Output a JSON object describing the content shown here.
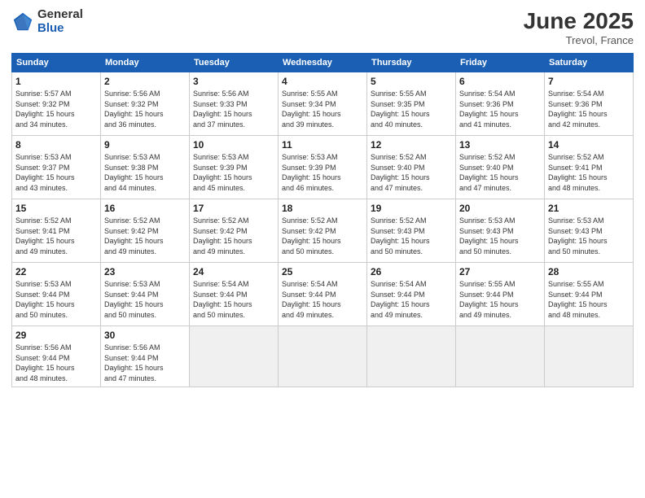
{
  "header": {
    "logo_general": "General",
    "logo_blue": "Blue",
    "title": "June 2025",
    "location": "Trevol, France"
  },
  "columns": [
    "Sunday",
    "Monday",
    "Tuesday",
    "Wednesday",
    "Thursday",
    "Friday",
    "Saturday"
  ],
  "weeks": [
    [
      {
        "day": "1",
        "info": "Sunrise: 5:57 AM\nSunset: 9:32 PM\nDaylight: 15 hours\nand 34 minutes."
      },
      {
        "day": "2",
        "info": "Sunrise: 5:56 AM\nSunset: 9:32 PM\nDaylight: 15 hours\nand 36 minutes."
      },
      {
        "day": "3",
        "info": "Sunrise: 5:56 AM\nSunset: 9:33 PM\nDaylight: 15 hours\nand 37 minutes."
      },
      {
        "day": "4",
        "info": "Sunrise: 5:55 AM\nSunset: 9:34 PM\nDaylight: 15 hours\nand 39 minutes."
      },
      {
        "day": "5",
        "info": "Sunrise: 5:55 AM\nSunset: 9:35 PM\nDaylight: 15 hours\nand 40 minutes."
      },
      {
        "day": "6",
        "info": "Sunrise: 5:54 AM\nSunset: 9:36 PM\nDaylight: 15 hours\nand 41 minutes."
      },
      {
        "day": "7",
        "info": "Sunrise: 5:54 AM\nSunset: 9:36 PM\nDaylight: 15 hours\nand 42 minutes."
      }
    ],
    [
      {
        "day": "8",
        "info": "Sunrise: 5:53 AM\nSunset: 9:37 PM\nDaylight: 15 hours\nand 43 minutes."
      },
      {
        "day": "9",
        "info": "Sunrise: 5:53 AM\nSunset: 9:38 PM\nDaylight: 15 hours\nand 44 minutes."
      },
      {
        "day": "10",
        "info": "Sunrise: 5:53 AM\nSunset: 9:39 PM\nDaylight: 15 hours\nand 45 minutes."
      },
      {
        "day": "11",
        "info": "Sunrise: 5:53 AM\nSunset: 9:39 PM\nDaylight: 15 hours\nand 46 minutes."
      },
      {
        "day": "12",
        "info": "Sunrise: 5:52 AM\nSunset: 9:40 PM\nDaylight: 15 hours\nand 47 minutes."
      },
      {
        "day": "13",
        "info": "Sunrise: 5:52 AM\nSunset: 9:40 PM\nDaylight: 15 hours\nand 47 minutes."
      },
      {
        "day": "14",
        "info": "Sunrise: 5:52 AM\nSunset: 9:41 PM\nDaylight: 15 hours\nand 48 minutes."
      }
    ],
    [
      {
        "day": "15",
        "info": "Sunrise: 5:52 AM\nSunset: 9:41 PM\nDaylight: 15 hours\nand 49 minutes."
      },
      {
        "day": "16",
        "info": "Sunrise: 5:52 AM\nSunset: 9:42 PM\nDaylight: 15 hours\nand 49 minutes."
      },
      {
        "day": "17",
        "info": "Sunrise: 5:52 AM\nSunset: 9:42 PM\nDaylight: 15 hours\nand 49 minutes."
      },
      {
        "day": "18",
        "info": "Sunrise: 5:52 AM\nSunset: 9:42 PM\nDaylight: 15 hours\nand 50 minutes."
      },
      {
        "day": "19",
        "info": "Sunrise: 5:52 AM\nSunset: 9:43 PM\nDaylight: 15 hours\nand 50 minutes."
      },
      {
        "day": "20",
        "info": "Sunrise: 5:53 AM\nSunset: 9:43 PM\nDaylight: 15 hours\nand 50 minutes."
      },
      {
        "day": "21",
        "info": "Sunrise: 5:53 AM\nSunset: 9:43 PM\nDaylight: 15 hours\nand 50 minutes."
      }
    ],
    [
      {
        "day": "22",
        "info": "Sunrise: 5:53 AM\nSunset: 9:44 PM\nDaylight: 15 hours\nand 50 minutes."
      },
      {
        "day": "23",
        "info": "Sunrise: 5:53 AM\nSunset: 9:44 PM\nDaylight: 15 hours\nand 50 minutes."
      },
      {
        "day": "24",
        "info": "Sunrise: 5:54 AM\nSunset: 9:44 PM\nDaylight: 15 hours\nand 50 minutes."
      },
      {
        "day": "25",
        "info": "Sunrise: 5:54 AM\nSunset: 9:44 PM\nDaylight: 15 hours\nand 49 minutes."
      },
      {
        "day": "26",
        "info": "Sunrise: 5:54 AM\nSunset: 9:44 PM\nDaylight: 15 hours\nand 49 minutes."
      },
      {
        "day": "27",
        "info": "Sunrise: 5:55 AM\nSunset: 9:44 PM\nDaylight: 15 hours\nand 49 minutes."
      },
      {
        "day": "28",
        "info": "Sunrise: 5:55 AM\nSunset: 9:44 PM\nDaylight: 15 hours\nand 48 minutes."
      }
    ],
    [
      {
        "day": "29",
        "info": "Sunrise: 5:56 AM\nSunset: 9:44 PM\nDaylight: 15 hours\nand 48 minutes."
      },
      {
        "day": "30",
        "info": "Sunrise: 5:56 AM\nSunset: 9:44 PM\nDaylight: 15 hours\nand 47 minutes."
      },
      {
        "day": "",
        "info": ""
      },
      {
        "day": "",
        "info": ""
      },
      {
        "day": "",
        "info": ""
      },
      {
        "day": "",
        "info": ""
      },
      {
        "day": "",
        "info": ""
      }
    ]
  ]
}
